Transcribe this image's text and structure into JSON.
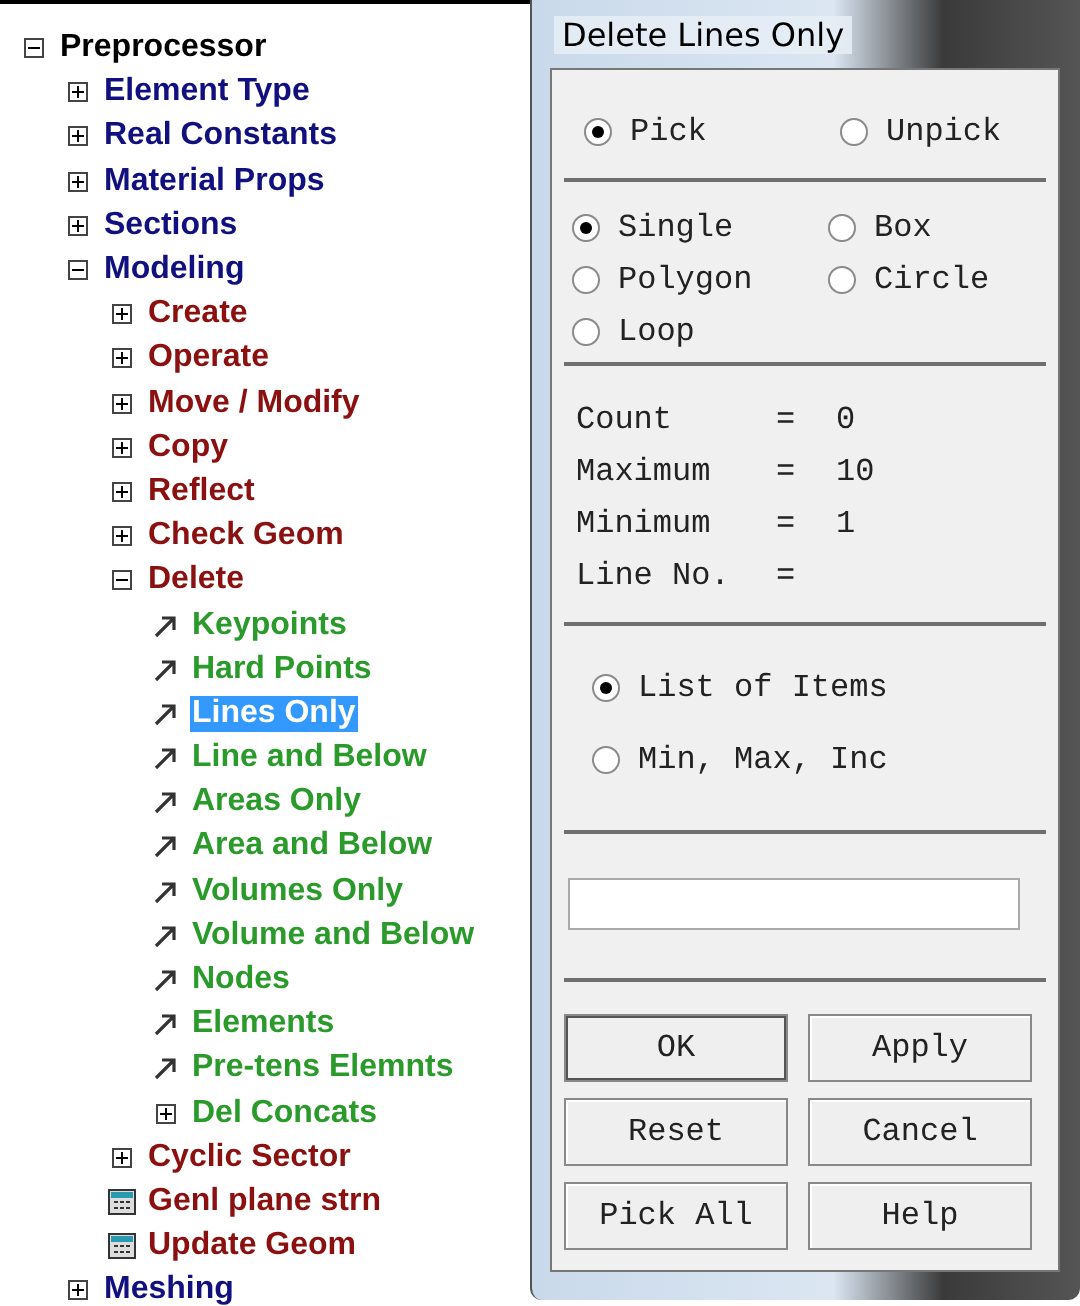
{
  "tree": {
    "label": "Preprocessor",
    "kind": "folder",
    "expanded": true,
    "selected": false,
    "children": [
      {
        "label": "Element Type",
        "kind": "folder",
        "expanded": false,
        "selected": false
      },
      {
        "label": "Real Constants",
        "kind": "folder",
        "expanded": false,
        "selected": false
      },
      {
        "label": "Material Props",
        "kind": "folder",
        "expanded": false,
        "selected": false
      },
      {
        "label": "Sections",
        "kind": "folder",
        "expanded": false,
        "selected": false
      },
      {
        "label": "Modeling",
        "kind": "folder",
        "expanded": true,
        "selected": false,
        "children": [
          {
            "label": "Create",
            "kind": "folder",
            "expanded": false,
            "selected": false
          },
          {
            "label": "Operate",
            "kind": "folder",
            "expanded": false,
            "selected": false
          },
          {
            "label": "Move / Modify",
            "kind": "folder",
            "expanded": false,
            "selected": false
          },
          {
            "label": "Copy",
            "kind": "folder",
            "expanded": false,
            "selected": false
          },
          {
            "label": "Reflect",
            "kind": "folder",
            "expanded": false,
            "selected": false
          },
          {
            "label": "Check Geom",
            "kind": "folder",
            "expanded": false,
            "selected": false
          },
          {
            "label": "Delete",
            "kind": "folder",
            "expanded": true,
            "selected": false,
            "children": [
              {
                "label": "Keypoints",
                "kind": "action",
                "selected": false
              },
              {
                "label": "Hard Points",
                "kind": "action",
                "selected": false
              },
              {
                "label": "Lines Only",
                "kind": "action",
                "selected": true
              },
              {
                "label": "Line and Below",
                "kind": "action",
                "selected": false
              },
              {
                "label": "Areas Only",
                "kind": "action",
                "selected": false
              },
              {
                "label": "Area and Below",
                "kind": "action",
                "selected": false
              },
              {
                "label": "Volumes Only",
                "kind": "action",
                "selected": false
              },
              {
                "label": "Volume and Below",
                "kind": "action",
                "selected": false
              },
              {
                "label": "Nodes",
                "kind": "action",
                "selected": false
              },
              {
                "label": "Elements",
                "kind": "action",
                "selected": false
              },
              {
                "label": "Pre-tens Elemnts",
                "kind": "action",
                "selected": false
              },
              {
                "label": "Del Concats",
                "kind": "folder",
                "expanded": false,
                "selected": false
              }
            ]
          },
          {
            "label": "Cyclic Sector",
            "kind": "folder",
            "expanded": false,
            "selected": false
          },
          {
            "label": "Genl plane strn",
            "kind": "dialog",
            "selected": false
          },
          {
            "label": "Update Geom",
            "kind": "dialog",
            "selected": false
          }
        ]
      },
      {
        "label": "Meshing",
        "kind": "folder",
        "expanded": false,
        "selected": false
      }
    ]
  },
  "dialog": {
    "title": "Delete Lines Only",
    "pick_mode": [
      {
        "label": "Pick",
        "selected": true
      },
      {
        "label": "Unpick",
        "selected": false
      }
    ],
    "selection": [
      {
        "label": "Single",
        "selected": true
      },
      {
        "label": "Box",
        "selected": false
      },
      {
        "label": "Polygon",
        "selected": false
      },
      {
        "label": "Circle",
        "selected": false
      },
      {
        "label": "Loop",
        "selected": false
      }
    ],
    "readouts": [
      {
        "label": "Count",
        "sign": "=",
        "value": "0"
      },
      {
        "label": "Maximum",
        "sign": "=",
        "value": "10"
      },
      {
        "label": "Minimum",
        "sign": "=",
        "value": "1"
      },
      {
        "label": "Line No.",
        "sign": "="
      }
    ],
    "list_mode": [
      {
        "label": "List of Items",
        "selected": true
      },
      {
        "label": "Min, Max, Inc",
        "selected": false
      }
    ],
    "buttons": [
      {
        "label": "OK",
        "default": true
      },
      {
        "label": "Apply",
        "default": false
      },
      {
        "label": "Reset",
        "default": false
      },
      {
        "label": "Cancel",
        "default": false
      },
      {
        "label": "Pick All",
        "default": false
      },
      {
        "label": "Help",
        "default": false
      }
    ]
  }
}
